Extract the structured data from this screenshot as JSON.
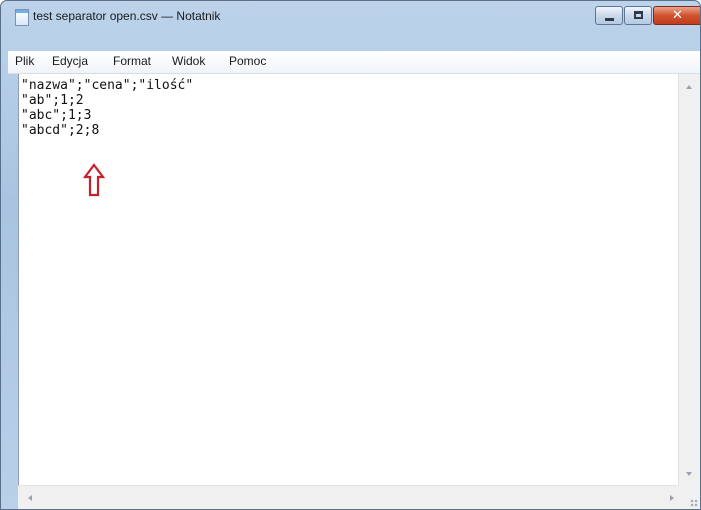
{
  "window": {
    "title": "test separator open.csv — Notatnik",
    "controls": {
      "close_glyph": "✕"
    }
  },
  "menubar": {
    "items": [
      "Plik",
      "Edycja",
      "Format",
      "Widok",
      "Pomoc"
    ]
  },
  "editor": {
    "lines": [
      "\"nazwa\";\"cena\";\"ilość\"",
      "\"ab\";1;2",
      "\"abc\";1;3",
      "\"abcd\";2;8"
    ],
    "annotation": {
      "icon": "up-arrow-icon",
      "color": "#c8202a"
    }
  },
  "colors": {
    "accent_close": "#c8402a",
    "annotation_red": "#c8202a"
  }
}
